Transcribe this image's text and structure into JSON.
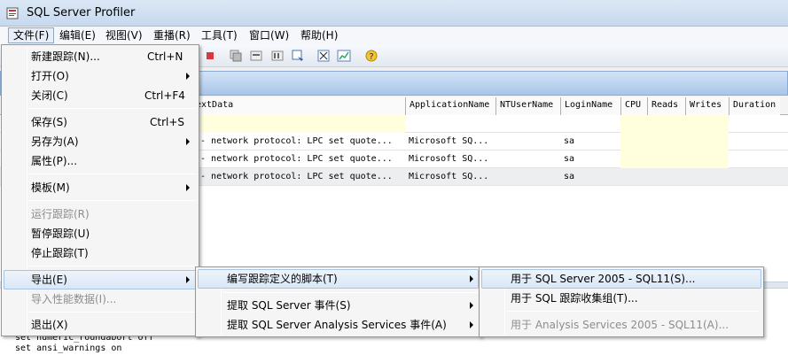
{
  "window": {
    "title": "SQL Server Profiler"
  },
  "menubar": [
    {
      "label": "文件(F)",
      "active": true
    },
    {
      "label": "编辑(E)"
    },
    {
      "label": "视图(V)"
    },
    {
      "label": "重播(R)"
    },
    {
      "label": "工具(T)"
    },
    {
      "label": "窗口(W)"
    },
    {
      "label": "帮助(H)"
    }
  ],
  "grid": {
    "columns": [
      "extData",
      "ApplicationName",
      "NTUserName",
      "LoginName",
      "CPU",
      "Reads",
      "Writes",
      "Duration"
    ],
    "rows": [
      [
        "-- network protocol: LPC  set quote...",
        "Microsoft SQ...",
        "",
        "sa",
        "",
        "",
        "",
        ""
      ],
      [
        "-- network protocol: LPC  set quote...",
        "Microsoft SQ...",
        "",
        "sa",
        "",
        "",
        "",
        ""
      ],
      [
        "-- network protocol: LPC  set quote...",
        "Microsoft SQ...",
        "",
        "sa",
        "",
        "",
        "",
        ""
      ]
    ]
  },
  "textpane": {
    "lines": [
      "set numeric_roundabort off",
      "set ansi_warnings on"
    ]
  },
  "file_menu": {
    "items": {
      "new_trace": {
        "label": "新建跟踪(N)...",
        "shortcut": "Ctrl+N"
      },
      "open": {
        "label": "打开(O)"
      },
      "close": {
        "label": "关闭(C)",
        "shortcut": "Ctrl+F4"
      },
      "save": {
        "label": "保存(S)",
        "shortcut": "Ctrl+S"
      },
      "save_as": {
        "label": "另存为(A)"
      },
      "properties": {
        "label": "属性(P)..."
      },
      "templates": {
        "label": "模板(M)"
      },
      "run_trace": {
        "label": "运行跟踪(R)"
      },
      "pause_trace": {
        "label": "暂停跟踪(U)"
      },
      "stop_trace": {
        "label": "停止跟踪(T)"
      },
      "export": {
        "label": "导出(E)"
      },
      "import_perf": {
        "label": "导入性能数据(I)..."
      },
      "exit": {
        "label": "退出(X)"
      }
    }
  },
  "export_menu": {
    "items": {
      "script_trace": {
        "label": "编写跟踪定义的脚本(T)"
      },
      "extract_sql": {
        "label": "提取 SQL Server 事件(S)"
      },
      "extract_as": {
        "label": "提取 SQL Server Analysis Services 事件(A)"
      }
    }
  },
  "script_menu": {
    "items": {
      "sql2005": {
        "label": "用于 SQL Server 2005 - SQL11(S)..."
      },
      "trace_collection": {
        "label": "用于 SQL 跟踪收集组(T)..."
      },
      "as2005": {
        "label": "用于 Analysis Services 2005 - SQL11(A)..."
      }
    }
  },
  "colors": {
    "highlight": "#dae7f6",
    "disabled_text": "#8d8d8d",
    "empty_column": "#ffffde"
  }
}
